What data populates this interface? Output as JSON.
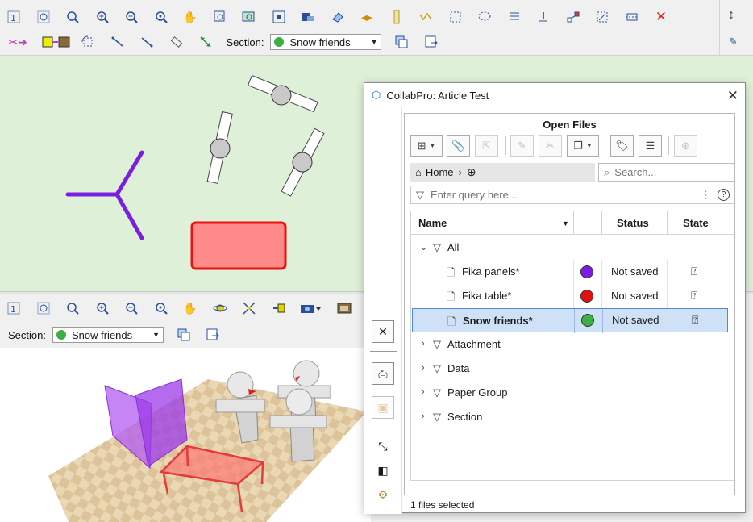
{
  "top_toolbar": {
    "row1_icons": [
      "fit-one-icon",
      "zoom-window-icon",
      "zoom-extents-icon",
      "zoom-in-icon",
      "zoom-out-icon",
      "zoom-previous-icon",
      "pan-hand-icon",
      "zoom-select-icon",
      "zoom-all-icon",
      "view-icon",
      "layer-icon",
      "eraser-icon",
      "arrows-icon",
      "ruler-icon",
      "polyline-icon",
      "rectangle-select-icon",
      "lasso-icon",
      "list-icon",
      "cursor-icon",
      "connect-icon",
      "move-icon",
      "trim-icon",
      "close-red-icon"
    ],
    "row2_icons": [
      "cut-paste-icon",
      "copy-image-icon",
      "rotate-copy-icon",
      "line-draw-icon",
      "line-draw-2-icon",
      "measure-icon",
      "dimension-icon"
    ],
    "section_label": "Section:",
    "section_value": "Snow friends",
    "section_color": "#3cb043"
  },
  "toolbar_3d": {
    "section_label": "Section:",
    "section_value": "Snow friends",
    "section_color": "#3cb043"
  },
  "collab": {
    "title": "CollabPro: Article Test",
    "panel_title": "Open Files",
    "breadcrumb_home": "Home",
    "search_placeholder": "Search...",
    "query_placeholder": "Enter query here...",
    "columns": {
      "name": "Name",
      "status": "Status",
      "state": "State"
    },
    "all_label": "All",
    "files": [
      {
        "name": "Fika panels*",
        "color": "#7a1fe0",
        "status": "Not saved",
        "selected": false
      },
      {
        "name": "Fika table*",
        "color": "#e01010",
        "status": "Not saved",
        "selected": false
      },
      {
        "name": "Snow friends*",
        "color": "#3cb043",
        "status": "Not saved",
        "selected": true
      }
    ],
    "groups": [
      "Attachment",
      "Data",
      "Paper Group",
      "Section"
    ],
    "footer": "1 files selected"
  }
}
